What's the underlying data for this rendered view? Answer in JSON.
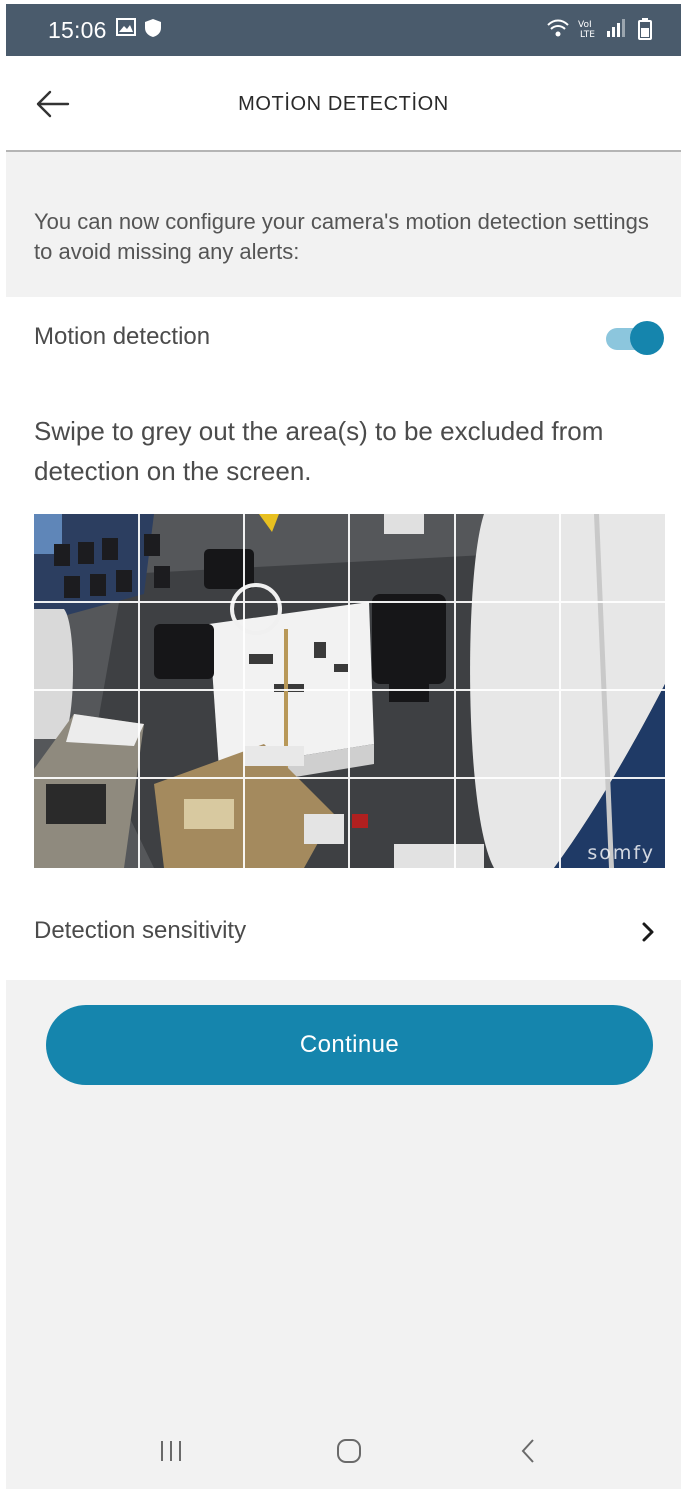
{
  "status_bar": {
    "time": "15:06",
    "left_icons": [
      "gallery-icon",
      "shield-icon"
    ],
    "right_icons": [
      "wifi-icon",
      "volte-icon",
      "signal-icon",
      "battery-icon"
    ]
  },
  "app_bar": {
    "title": "MOTİON DETECTİON",
    "back_icon": "arrow-left-icon"
  },
  "intro_text": "You can now configure your camera's motion detection settings to avoid missing any alerts:",
  "motion_detection": {
    "label": "Motion detection",
    "enabled": true
  },
  "zones": {
    "instructions": "Swipe to grey out the area(s) to be excluded from detection on the screen.",
    "columns": 6,
    "rows": 4,
    "brand_watermark": "somfy"
  },
  "sensitivity": {
    "label": "Detection sensitivity",
    "icon": "chevron-right-icon"
  },
  "continue_button": {
    "label": "Continue"
  },
  "nav_bar": {
    "icons": [
      "recents-icon",
      "home-icon",
      "back-icon"
    ]
  },
  "colors": {
    "accent": "#1585ad",
    "toggle_track": "#8cc6dd",
    "status_bar": "#4a5b6c",
    "background": "#f2f2f2"
  }
}
